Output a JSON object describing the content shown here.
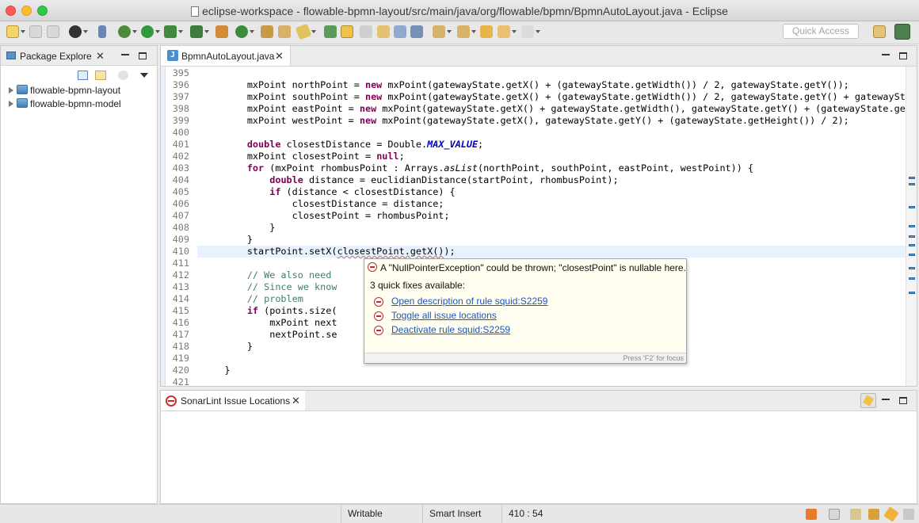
{
  "window": {
    "title": "eclipse-workspace - flowable-bpmn-layout/src/main/java/org/flowable/bpmn/BpmnAutoLayout.java - Eclipse"
  },
  "toolbar": {
    "quick_access_placeholder": "Quick Access"
  },
  "package_explorer": {
    "tab_label": "Package Explore",
    "projects": [
      "flowable-bpmn-layout",
      "flowable-bpmn-model"
    ]
  },
  "editor": {
    "tab_label": "BpmnAutoLayout.java",
    "current_line": 410,
    "lines": [
      {
        "no": "395",
        "text": ""
      },
      {
        "no": "396",
        "text": "        mxPoint northPoint = new mxPoint(gatewayState.getX() + (gatewayState.getWidth()) / 2, gatewayState.getY());"
      },
      {
        "no": "397",
        "text": "        mxPoint southPoint = new mxPoint(gatewayState.getX() + (gatewayState.getWidth()) / 2, gatewayState.getY() + gatewaySta"
      },
      {
        "no": "398",
        "text": "        mxPoint eastPoint = new mxPoint(gatewayState.getX() + gatewayState.getWidth(), gatewayState.getY() + (gatewayState.getHe"
      },
      {
        "no": "399",
        "text": "        mxPoint westPoint = new mxPoint(gatewayState.getX(), gatewayState.getY() + (gatewayState.getHeight()) / 2);"
      },
      {
        "no": "400",
        "text": ""
      },
      {
        "no": "401",
        "text": "        double closestDistance = Double.MAX_VALUE;"
      },
      {
        "no": "402",
        "text": "        mxPoint closestPoint = null;"
      },
      {
        "no": "403",
        "text": "        for (mxPoint rhombusPoint : Arrays.asList(northPoint, southPoint, eastPoint, westPoint)) {"
      },
      {
        "no": "404",
        "text": "            double distance = euclidianDistance(startPoint, rhombusPoint);"
      },
      {
        "no": "405",
        "text": "            if (distance < closestDistance) {"
      },
      {
        "no": "406",
        "text": "                closestDistance = distance;"
      },
      {
        "no": "407",
        "text": "                closestPoint = rhombusPoint;"
      },
      {
        "no": "408",
        "text": "            }"
      },
      {
        "no": "409",
        "text": "        }"
      },
      {
        "no": "410",
        "text": "        startPoint.setX(closestPoint.getX());"
      },
      {
        "no": "411",
        "text": ""
      },
      {
        "no": "412",
        "text": "        // We also need"
      },
      {
        "no": "413",
        "text": "        // Since we know"
      },
      {
        "no": "414",
        "text": "        // problem"
      },
      {
        "no": "415",
        "text": "        if (points.size("
      },
      {
        "no": "416",
        "text": "            mxPoint next"
      },
      {
        "no": "417",
        "text": "            nextPoint.se"
      },
      {
        "no": "418",
        "text": "        }"
      },
      {
        "no": "419",
        "text": ""
      },
      {
        "no": "420",
        "text": "    }"
      },
      {
        "no": "421",
        "text": ""
      }
    ]
  },
  "popup": {
    "message": "A \"NullPointerException\" could be thrown; \"closestPoint\" is nullable here.",
    "subtitle": "3 quick fixes available:",
    "fixes": [
      "Open description of rule squid:S2259",
      "Toggle all issue locations",
      "Deactivate rule squid:S2259"
    ],
    "footer": "Press 'F2' for focus"
  },
  "sonarlint": {
    "tab_label": "SonarLint Issue Locations"
  },
  "status": {
    "writable": "Writable",
    "insert_mode": "Smart Insert",
    "position": "410 : 54"
  }
}
